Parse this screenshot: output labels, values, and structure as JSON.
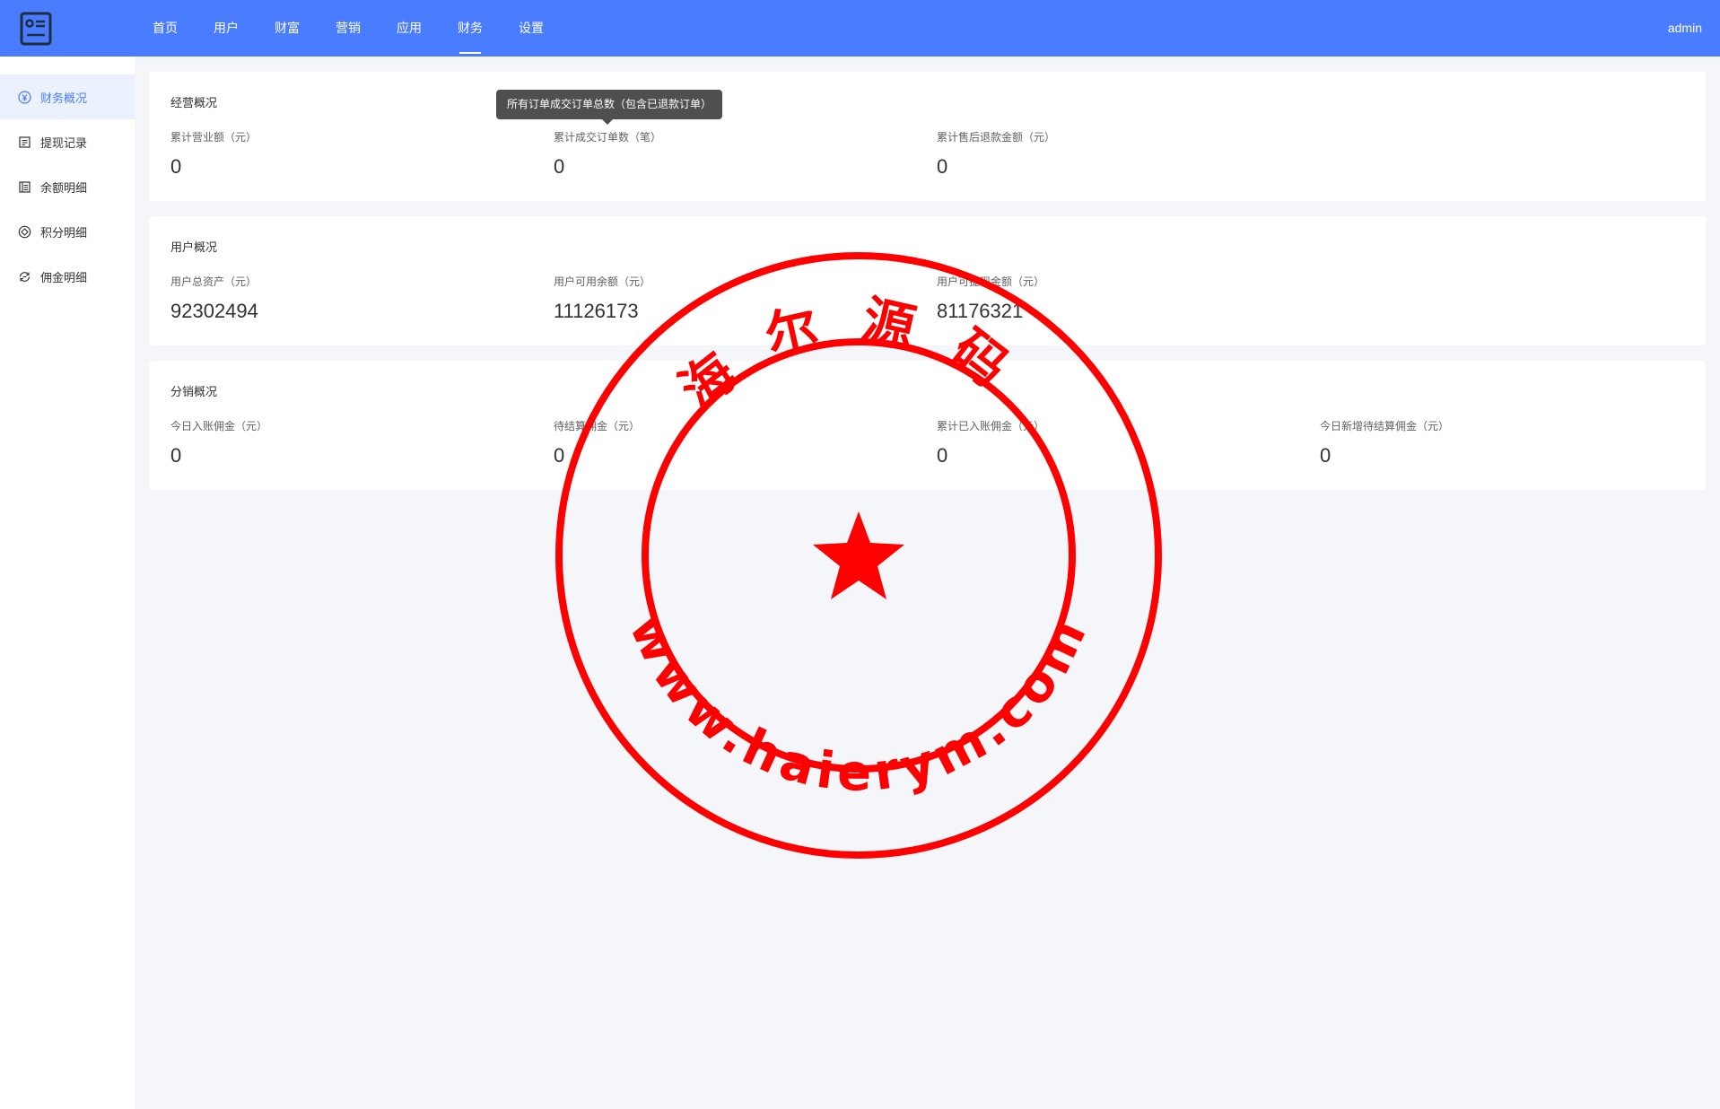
{
  "header": {
    "logo_icon": "dashboard-card-icon",
    "nav": [
      {
        "label": "首页"
      },
      {
        "label": "用户"
      },
      {
        "label": "财富"
      },
      {
        "label": "营销"
      },
      {
        "label": "应用"
      },
      {
        "label": "财务",
        "active": true
      },
      {
        "label": "设置"
      }
    ],
    "user": "admin"
  },
  "sidebar": {
    "items": [
      {
        "label": "财务概况",
        "icon": "yen-circle-icon",
        "active": true
      },
      {
        "label": "提现记录",
        "icon": "record-list-icon"
      },
      {
        "label": "余额明细",
        "icon": "ledger-icon"
      },
      {
        "label": "积分明细",
        "icon": "points-icon"
      },
      {
        "label": "佣金明细",
        "icon": "commission-icon"
      }
    ]
  },
  "business": {
    "title": "经营概况",
    "stats": [
      {
        "label": "累计营业额（元）",
        "value": "0"
      },
      {
        "label": "累计成交订单数（笔）",
        "value": "0"
      },
      {
        "label": "累计售后退款金额（元）",
        "value": "0"
      }
    ],
    "tooltip": "所有订单成交订单总数（包含已退款订单）"
  },
  "users": {
    "title": "用户概况",
    "stats": [
      {
        "label": "用户总资产（元）",
        "value": "92302494"
      },
      {
        "label": "用户可用余额（元）",
        "value": "11126173"
      },
      {
        "label": "用户可提现金额（元）",
        "value": "81176321"
      }
    ]
  },
  "distribution": {
    "title": "分销概况",
    "stats": [
      {
        "label": "今日入账佣金（元）",
        "value": "0"
      },
      {
        "label": "待结算佣金（元）",
        "value": "0"
      },
      {
        "label": "累计已入账佣金（元）",
        "value": "0"
      },
      {
        "label": "今日新增待结算佣金（元）",
        "value": "0"
      }
    ]
  },
  "watermark": {
    "name": "海尔源码",
    "url": "www.haierym.com"
  },
  "colors": {
    "primary": "#4a7cff",
    "seal": "#ff0000"
  }
}
